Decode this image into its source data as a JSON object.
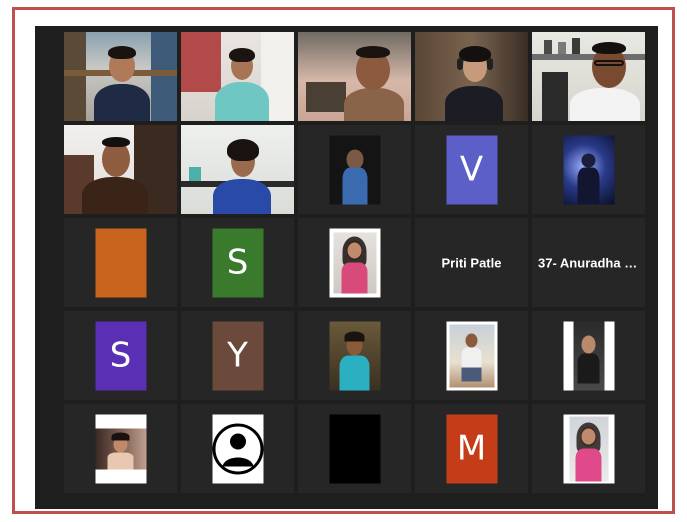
{
  "meeting": {
    "frame_color": "#c0504d",
    "background_color": "#1e1e1e",
    "tile_color": "#262626",
    "active_speaker_border": "#d8e07a"
  },
  "participants": [
    {
      "kind": "video",
      "icon": "participant-video",
      "active": false
    },
    {
      "kind": "video",
      "icon": "participant-video",
      "active": false
    },
    {
      "kind": "video",
      "icon": "participant-video",
      "active": false
    },
    {
      "kind": "video",
      "icon": "participant-video",
      "active": false
    },
    {
      "kind": "video",
      "icon": "participant-video",
      "active": true
    },
    {
      "kind": "video",
      "icon": "participant-video",
      "active": false
    },
    {
      "kind": "video",
      "icon": "participant-video",
      "active": false
    },
    {
      "kind": "photo",
      "icon": "profile-photo"
    },
    {
      "kind": "letter",
      "letter": "V",
      "color": "#5b5fc7"
    },
    {
      "kind": "photo",
      "icon": "profile-photo"
    },
    {
      "kind": "color",
      "color": "#c8641e"
    },
    {
      "kind": "letter",
      "letter": "S",
      "color": "#3a7a2c"
    },
    {
      "kind": "photo",
      "icon": "profile-photo"
    },
    {
      "kind": "name",
      "name": "Priti Patle"
    },
    {
      "kind": "name",
      "name": "37- Anuradha S..."
    },
    {
      "kind": "letter",
      "letter": "S",
      "color": "#5b2fb3"
    },
    {
      "kind": "letter",
      "letter": "Y",
      "color": "#6b4a3c"
    },
    {
      "kind": "photo",
      "icon": "profile-photo"
    },
    {
      "kind": "photo",
      "icon": "profile-photo"
    },
    {
      "kind": "photo",
      "icon": "profile-photo"
    },
    {
      "kind": "photo",
      "icon": "profile-photo"
    },
    {
      "kind": "photo",
      "icon": "default-user-silhouette"
    },
    {
      "kind": "color",
      "color": "#000000"
    },
    {
      "kind": "letter",
      "letter": "M",
      "color": "#c43d18"
    },
    {
      "kind": "photo",
      "icon": "profile-photo"
    }
  ]
}
